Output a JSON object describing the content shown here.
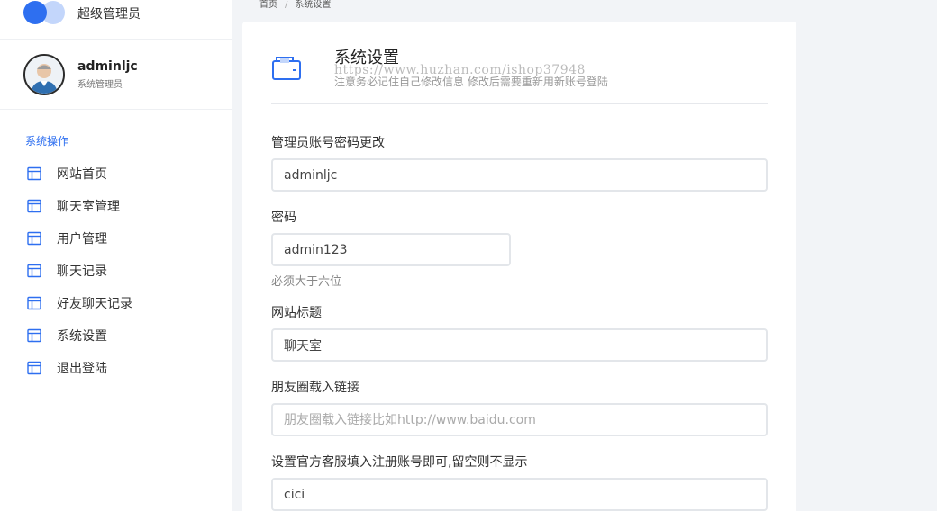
{
  "brand": {
    "title": "超级管理员"
  },
  "profile": {
    "name": "adminljc",
    "role": "系统管理员"
  },
  "nav": {
    "section_title": "系统操作",
    "items": [
      {
        "label": "网站首页",
        "icon": "layout-icon"
      },
      {
        "label": "聊天室管理",
        "icon": "layout-icon"
      },
      {
        "label": "用户管理",
        "icon": "layout-icon"
      },
      {
        "label": "聊天记录",
        "icon": "layout-icon"
      },
      {
        "label": "好友聊天记录",
        "icon": "layout-icon"
      },
      {
        "label": "系统设置",
        "icon": "layout-icon"
      },
      {
        "label": "退出登陆",
        "icon": "layout-icon"
      }
    ]
  },
  "breadcrumb": {
    "home": "首页",
    "separator": "/",
    "current": "系统设置"
  },
  "card": {
    "title": "系统设置",
    "subtitle": "注意务必记住自己修改信息 修改后需要重新用新账号登陆",
    "watermark": "https://www.huzhan.com/ishop37948"
  },
  "form": {
    "account": {
      "label": "管理员账号密码更改",
      "value": "adminljc"
    },
    "password": {
      "label": "密码",
      "value": "admin123",
      "hint": "必须大于六位"
    },
    "site_title": {
      "label": "网站标题",
      "value": "聊天室"
    },
    "moments_link": {
      "label": "朋友圈载入链接",
      "value": "",
      "placeholder": "朋友圈载入链接比如http://www.baidu.com"
    },
    "service": {
      "label": "设置官方客服填入注册账号即可,留空则不显示",
      "value": "cici"
    }
  },
  "colors": {
    "accent": "#2e6ff0",
    "accent_light": "#c3d6fb",
    "background": "#f2f4f7"
  }
}
